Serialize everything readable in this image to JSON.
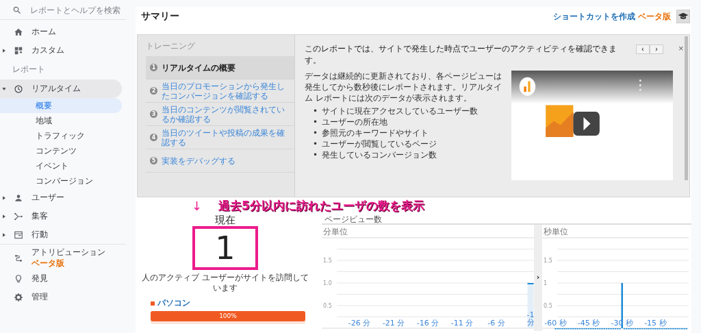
{
  "sidebar": {
    "search": {
      "placeholder": "レポートとヘルプを検索"
    },
    "top_items": [
      {
        "kind": "link",
        "label": "ホーム"
      },
      {
        "kind": "group",
        "label": "カスタム",
        "expanded": false
      }
    ],
    "section_label": "レポート",
    "report_items": [
      {
        "kind": "group",
        "label": "リアルタイム",
        "expanded": true,
        "children": [
          {
            "label": "概要",
            "selected": true
          },
          {
            "label": "地域",
            "selected": false
          },
          {
            "label": "トラフィック",
            "selected": false
          },
          {
            "label": "コンテンツ",
            "selected": false
          },
          {
            "label": "イベント",
            "selected": false
          },
          {
            "label": "コンバージョン",
            "selected": false
          }
        ]
      },
      {
        "kind": "group",
        "label": "ユーザー",
        "expanded": false
      },
      {
        "kind": "group",
        "label": "集客",
        "expanded": false
      },
      {
        "kind": "group",
        "label": "行動",
        "expanded": false
      }
    ],
    "bottom_items": [
      {
        "label": "アトリビューション",
        "badge": "ベータ版"
      },
      {
        "label": "発見"
      },
      {
        "label": "管理"
      }
    ]
  },
  "header": {
    "title": "サマリー",
    "shortcut_link": "ショートカットを作成",
    "badge": "ベータ版"
  },
  "training": {
    "label": "トレーニング",
    "steps": [
      {
        "number": "1",
        "label": "リアルタイムの概要",
        "selected": true
      },
      {
        "number": "2",
        "label": "当日のプロモーションから発生したコンバージョンを確認する",
        "selected": false
      },
      {
        "number": "3",
        "label": "当日のコンテンツが閲覧されているか確認する",
        "selected": false
      },
      {
        "number": "4",
        "label": "当日のツイートや投稿の成果を確認する",
        "selected": false
      },
      {
        "number": "5",
        "label": "実装をデバッグする",
        "selected": false
      }
    ],
    "heading": "このレポートでは、サイトで発生した時点でユーザーのアクティビティを確認できます。",
    "prev": "‹",
    "next": "›",
    "close": "×",
    "body": "データは継続的に更新されており、各ページビューは発生してから数秒後にレポートされます。リアルタイム レポートには次のデータが表示されます。",
    "bullet_marker": "•",
    "bullets": [
      "サイトに現在アクセスしているユーザー数",
      "ユーザーの所在地",
      "参照元のキーワードやサイト",
      "ユーザーが閲覧しているページ",
      "発生しているコンバージョン数"
    ],
    "video": {
      "kind": "picture"
    }
  },
  "active_users": {
    "now_label": "現在",
    "count": "1",
    "caption": "人のアクティブ ユーザーがサイトを訪問しています",
    "devices": [
      {
        "label": "パソコン",
        "color": "#f05a22",
        "level": 1,
        "reading": "100%"
      }
    ]
  },
  "annotation": {
    "arrow": "↓",
    "text": "過去5分以内に訪れたユーザの数を表示"
  },
  "pageviews": {
    "title": "ページビュー数",
    "collapse": "›",
    "charts": [
      {
        "subtitle": "分単位",
        "chart_data": {
          "type": "bar",
          "x": [
            -31,
            -30,
            -29,
            -28,
            -27,
            -26,
            -25,
            -24,
            -23,
            -22,
            -21,
            -20,
            -19,
            -18,
            -17,
            -16,
            -15,
            -14,
            -13,
            -12,
            -11,
            -10,
            -9,
            -8,
            -7,
            -6,
            -5,
            -4,
            -3,
            -2,
            -1
          ],
          "values": [
            0,
            0,
            0,
            0,
            0,
            0,
            0,
            0,
            0,
            0,
            0,
            0,
            0,
            0,
            0,
            0,
            0,
            0,
            0,
            0,
            0,
            0,
            0,
            0,
            0,
            0,
            0,
            0,
            0,
            0,
            1
          ],
          "xlim": [
            -31.5,
            -0.5
          ],
          "ylim": [
            0,
            2
          ],
          "grid": true,
          "yticks": [
            {
              "value": 0.5,
              "label": "0.5"
            },
            {
              "value": 1,
              "label": "1.0"
            },
            {
              "value": 1.5,
              "label": "1.5"
            }
          ],
          "xticks": [
            {
              "value": -26,
              "label": "-26 分"
            },
            {
              "value": -21,
              "label": "-21 分"
            },
            {
              "value": -16,
              "label": "-16 分"
            },
            {
              "value": -11,
              "label": "-11 分"
            },
            {
              "value": -6,
              "label": "-6 分"
            },
            {
              "value": -1,
              "label": "-1 分"
            }
          ]
        }
      },
      {
        "subtitle": "秒単位",
        "chart_data": {
          "type": "bar",
          "x": [
            -60,
            -59,
            -58,
            -57,
            -56,
            -55,
            -54,
            -53,
            -52,
            -51,
            -50,
            -49,
            -48,
            -47,
            -46,
            -45,
            -44,
            -43,
            -42,
            -41,
            -40,
            -39,
            -38,
            -37,
            -36,
            -35,
            -34,
            -33,
            -32,
            -31,
            -30,
            -29,
            -28,
            -27,
            -26,
            -25,
            -24,
            -23,
            -22,
            -21,
            -20,
            -19,
            -18,
            -17,
            -16,
            -15,
            -14,
            -13,
            -12,
            -11,
            -10,
            -9,
            -8,
            -7,
            -6,
            -5,
            -4,
            -3,
            -2,
            -1
          ],
          "values": [
            0,
            0,
            0,
            0,
            0,
            0,
            0,
            0,
            0,
            0,
            0,
            0,
            0,
            0,
            0,
            0,
            0,
            0,
            0,
            0,
            0,
            0,
            0,
            0,
            0,
            0,
            0,
            0,
            0,
            0,
            1,
            0,
            0,
            0,
            0,
            0,
            0,
            0,
            0,
            0,
            0,
            0,
            0,
            0,
            0,
            0,
            0,
            0,
            0,
            0,
            0,
            0,
            0,
            0,
            0,
            0,
            0,
            0,
            0,
            0
          ],
          "xlim": [
            -66,
            0
          ],
          "ylim": [
            0,
            2
          ],
          "grid": true,
          "yticks": [
            {
              "value": 0.5,
              "label": "0.5"
            },
            {
              "value": 1,
              "label": "1"
            },
            {
              "value": 1.5,
              "label": "1.5"
            }
          ],
          "xticks": [
            {
              "value": -60,
              "label": "-60 秒"
            },
            {
              "value": -45,
              "label": "-45 秒"
            },
            {
              "value": -30,
              "label": "-30 秒"
            },
            {
              "value": -15,
              "label": "-15 秒"
            }
          ]
        }
      }
    ]
  }
}
